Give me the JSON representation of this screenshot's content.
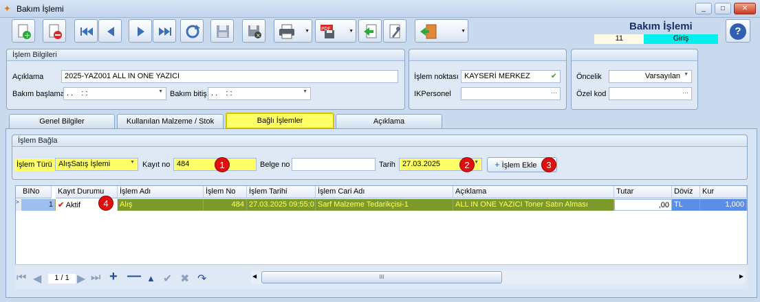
{
  "window": {
    "title": "Bakım İşlemi",
    "controls": [
      "_",
      "□",
      "✕"
    ]
  },
  "header": {
    "title": "Bakım İşlemi",
    "counter": "11",
    "mode": "Giriş",
    "help": "?"
  },
  "islem_bilgileri": {
    "legend": "İşlem Bilgileri",
    "aciklama_label": "Açıklama",
    "aciklama_value": "2025-YAZ001 ALL IN ONE YAZICI",
    "baslama_label": "Bakım başlama",
    "baslama_value": ". .    : :",
    "bitis_label": "Bakım bitiş",
    "bitis_value": ". .    : :"
  },
  "mid": {
    "islem_noktasi_label": "İşlem noktası",
    "islem_noktasi_value": "KAYSERİ MERKEZ",
    "ikpersonel_label": "IKPersonel",
    "ellipsis": "···"
  },
  "right": {
    "oncelik_label": "Öncelik",
    "oncelik_value": "Varsayılan",
    "ozel_kod_label": "Özel kod",
    "ellipsis": "···"
  },
  "tabs": [
    {
      "label": "Genel Bilgiler"
    },
    {
      "label": "Kullanılan Malzeme / Stok"
    },
    {
      "label": "Bağlı İşlemler"
    },
    {
      "label": "Açıklama"
    }
  ],
  "islem_bagla": {
    "legend": "İşlem Bağla",
    "tur_label": "İşlem Türü",
    "tur_value": "AlışSatış İşlemi",
    "kayit_label": "Kayıt no",
    "kayit_value": "484",
    "belge_label": "Belge no",
    "belge_value": "",
    "tarih_label": "Tarih",
    "tarih_value": "27.03.2025",
    "ekle_label": "İşlem Ekle"
  },
  "badges": [
    "1",
    "2",
    "3",
    "4"
  ],
  "grid": {
    "columns": [
      "BINo",
      "Kayıt Durumu",
      "İşlem Adı",
      "İşlem No",
      "İşlem Tarihi",
      "İşlem Cari Adı",
      "Açıklama",
      "Tutar",
      "Döviz",
      "Kur"
    ],
    "row": {
      "bino": "1",
      "durum": "Aktif",
      "islem_adi": "Alış",
      "islem_no": "484",
      "tarih": "27.03.2025 09:55:0",
      "cari": "Sarf Malzeme Tedarikçisi-1",
      "aciklama": "ALL IN ONE YAZICI Toner Satın Alması",
      "tutar": ",00",
      "doviz": "TL",
      "kur": "1,000"
    }
  },
  "navigator": {
    "page": "1 / 1",
    "scroll_grip": "III"
  },
  "colors": {
    "highlight": "#ffff66",
    "row_bg": "#7c9a2c",
    "row_text": "#ffff60",
    "badge": "#e01010",
    "mode_bg": "#00f0f0"
  }
}
